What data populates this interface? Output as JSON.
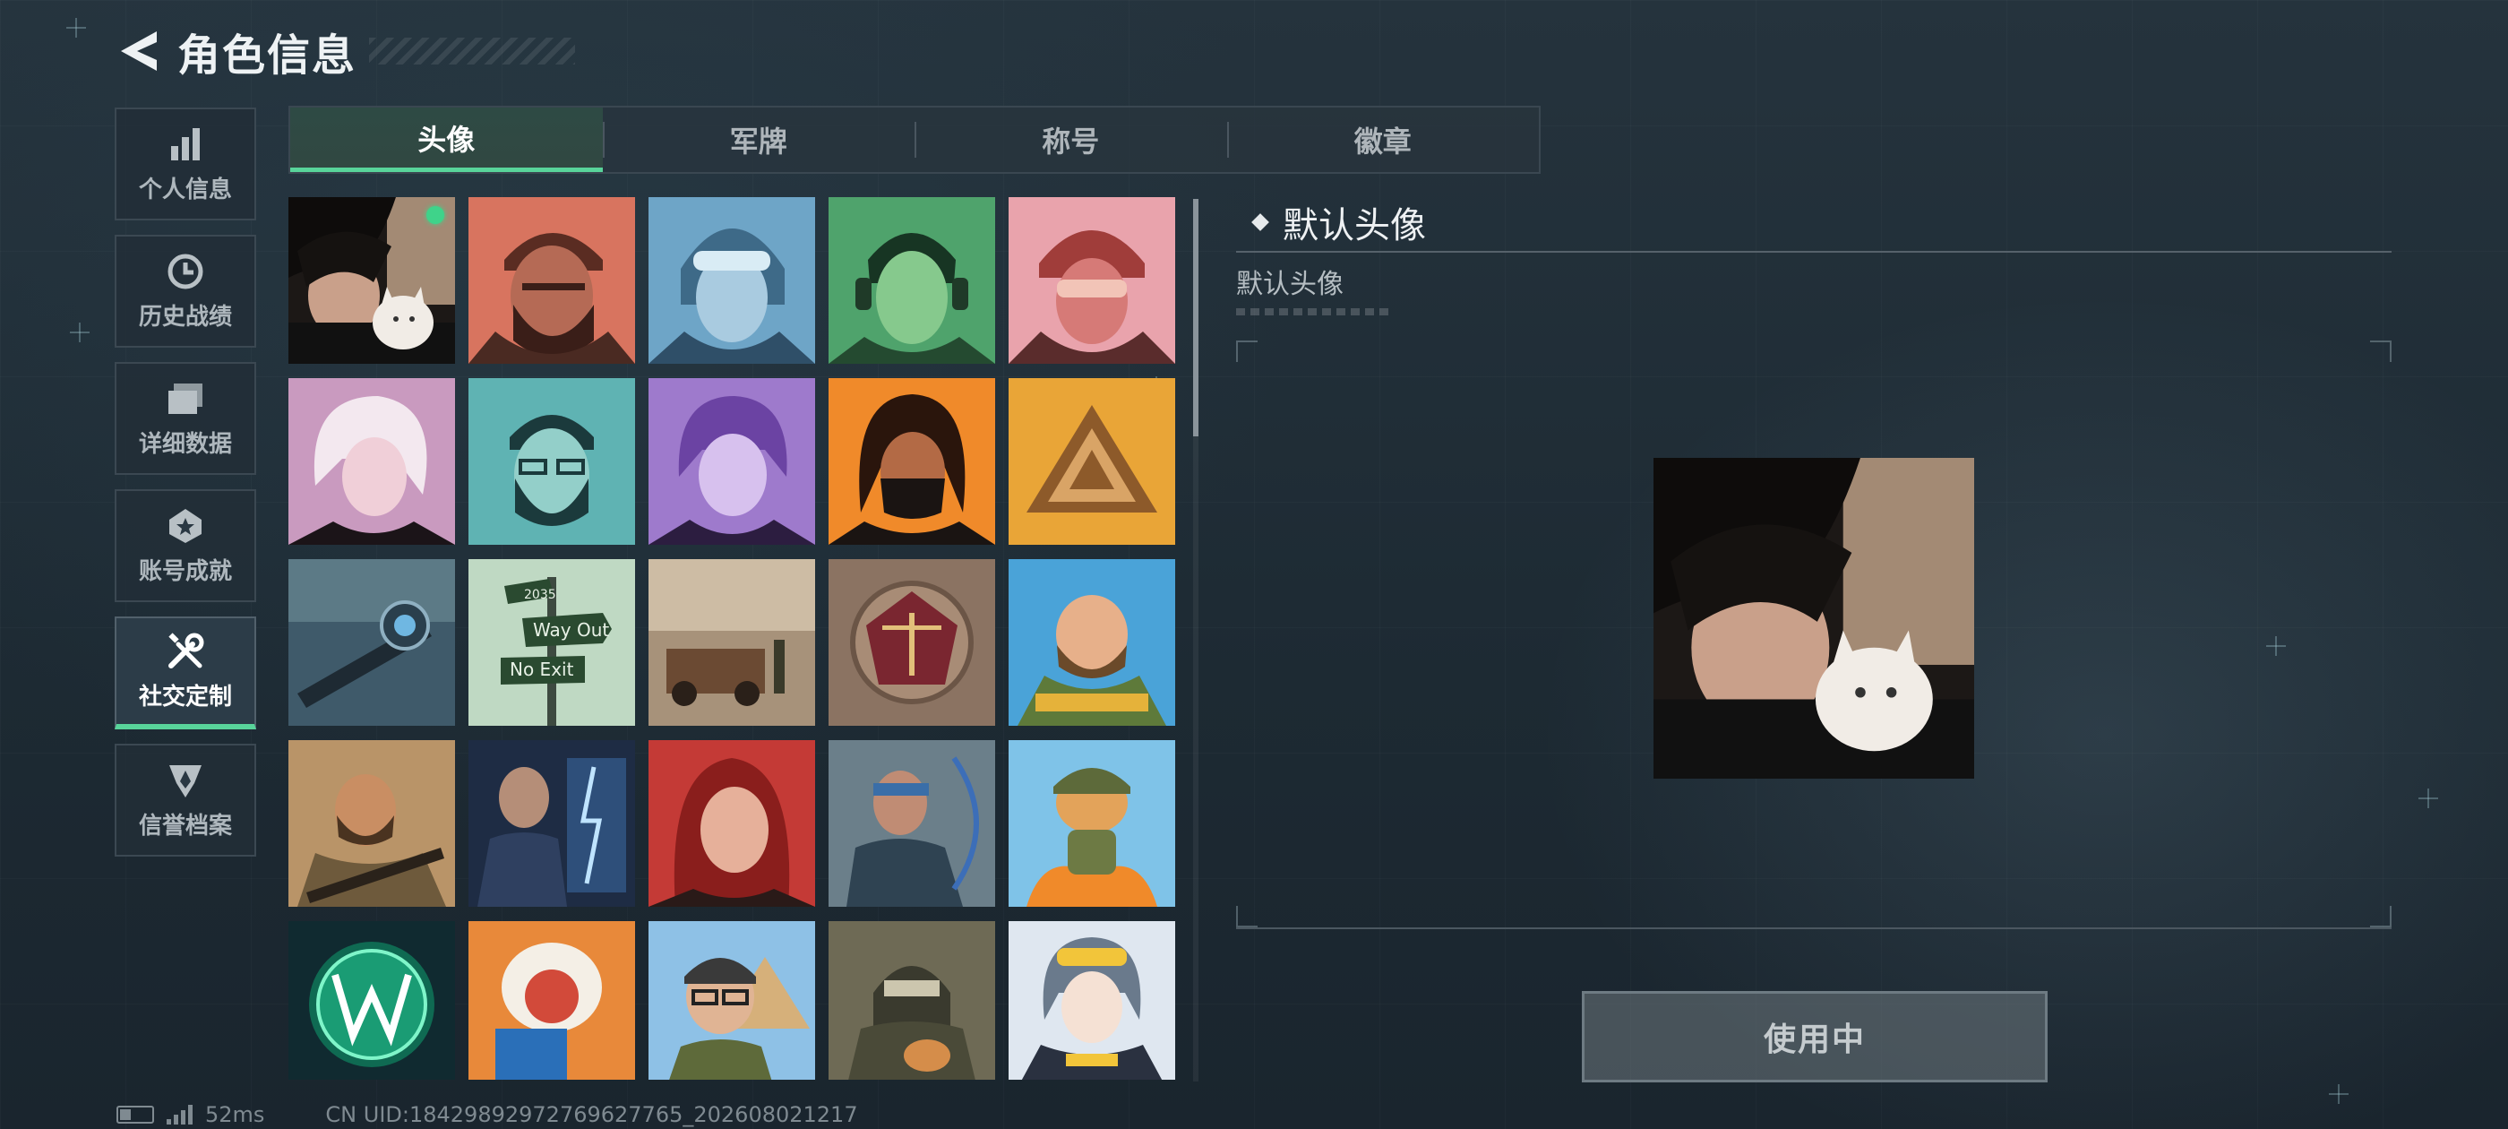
{
  "header": {
    "title": "角色信息"
  },
  "sidebar": {
    "items": [
      {
        "label": "个人信息",
        "icon": "bar-chart-icon",
        "active": false
      },
      {
        "label": "历史战绩",
        "icon": "history-clock-icon",
        "active": false
      },
      {
        "label": "详细数据",
        "icon": "folder-icon",
        "active": false
      },
      {
        "label": "账号成就",
        "icon": "medal-icon",
        "active": false
      },
      {
        "label": "社交定制",
        "icon": "wrench-screwdriver-icon",
        "active": true
      },
      {
        "label": "信誉档案",
        "icon": "shield-emblem-icon",
        "active": false
      }
    ]
  },
  "tabs": [
    {
      "label": "头像",
      "active": true
    },
    {
      "label": "军牌",
      "active": false
    },
    {
      "label": "称号",
      "active": false
    },
    {
      "label": "徽章",
      "active": false
    }
  ],
  "avatars": [
    {
      "name": "cat-photo",
      "selected": true,
      "equipped": true
    },
    {
      "name": "bearded-operator-cap"
    },
    {
      "name": "pilot-goggles-woman"
    },
    {
      "name": "headset-operator-green"
    },
    {
      "name": "helmet-operator-pink"
    },
    {
      "name": "white-hair-girl"
    },
    {
      "name": "glasses-bearded-teal"
    },
    {
      "name": "purple-hair-girl"
    },
    {
      "name": "masked-long-hair"
    },
    {
      "name": "golden-triangle-emblem"
    },
    {
      "name": "sniper-scope-rifle"
    },
    {
      "name": "way-out-sign",
      "sign_top": "2035",
      "sign_mid": "Way Out",
      "sign_low": "No Exit"
    },
    {
      "name": "desert-wreck-soldier"
    },
    {
      "name": "scales-crest"
    },
    {
      "name": "cartoon-bearded-cook"
    },
    {
      "name": "desert-rifleman"
    },
    {
      "name": "suit-man-lightning"
    },
    {
      "name": "red-hair-woman"
    },
    {
      "name": "archer-woman"
    },
    {
      "name": "cartoon-dog-soldier"
    },
    {
      "name": "neon-logo"
    },
    {
      "name": "monkey-book"
    },
    {
      "name": "glasses-pyramid-man"
    },
    {
      "name": "masked-soldier-cat"
    },
    {
      "name": "anime-girl-goggles"
    }
  ],
  "detail": {
    "title": "默认头像",
    "description": "默认头像"
  },
  "action": {
    "label": "使用中"
  },
  "status": {
    "ping": "52ms",
    "uid": "CN UID:18429892972769627765_202608021217"
  },
  "colors": {
    "accent": "#58d49a",
    "equipped": "#3fd38a"
  }
}
